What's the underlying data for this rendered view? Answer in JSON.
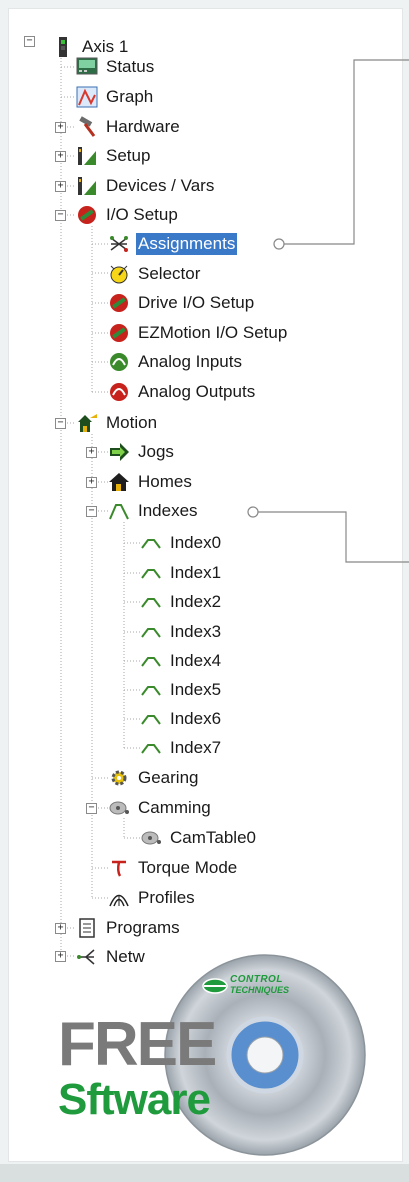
{
  "tree": {
    "root": "Axis 1",
    "status": "Status",
    "graph": "Graph",
    "hardware": "Hardware",
    "setup": "Setup",
    "devices_vars": "Devices / Vars",
    "io_setup": "I/O Setup",
    "assignments": "Assignments",
    "selector": "Selector",
    "drive_io_setup": "Drive I/O Setup",
    "ezmotion_io_setup": "EZMotion I/O Setup",
    "analog_inputs": "Analog Inputs",
    "analog_outputs": "Analog Outputs",
    "motion": "Motion",
    "jogs": "Jogs",
    "homes": "Homes",
    "indexes": "Indexes",
    "index_items": [
      "Index0",
      "Index1",
      "Index2",
      "Index3",
      "Index4",
      "Index5",
      "Index6",
      "Index7"
    ],
    "gearing": "Gearing",
    "camming": "Camming",
    "camtable": "CamTable0",
    "torque_mode": "Torque Mode",
    "profiles": "Profiles",
    "programs": "Programs",
    "network": "Netw"
  },
  "promo": {
    "brand_line1": "CONTROL",
    "brand_line2": "TECHNIQUES",
    "free_word": "FREE",
    "software_s": "S",
    "software_rest": "ftware"
  },
  "icons": {
    "root": "axis-icon",
    "status": "status-monitor-icon",
    "graph": "graph-icon",
    "hardware": "hammer-icon",
    "setup": "setup-icon",
    "io": "io-icon",
    "assignments": "assignments-icon",
    "selector": "selector-icon",
    "analog": "analog-icon",
    "motion": "motion-icon",
    "jogs": "arrow-icon",
    "homes": "home-icon",
    "indexes": "index-profile-icon",
    "gearing": "gear-icon",
    "camming": "cam-icon",
    "torque": "torque-icon",
    "profiles": "profiles-icon",
    "programs": "program-icon",
    "network": "network-icon"
  },
  "colors": {
    "selection": "#3a78c8",
    "brand_green": "#1f9a3c",
    "free_gray": "#7a7a7a"
  }
}
